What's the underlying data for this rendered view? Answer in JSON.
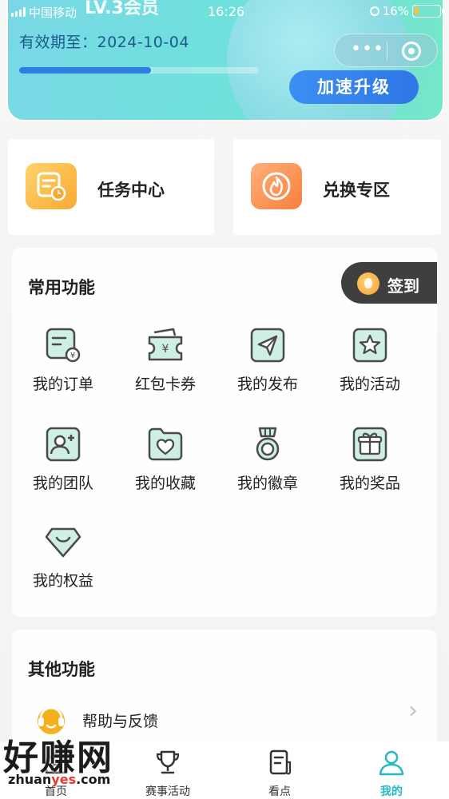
{
  "status_bar": {
    "carrier": "中国移动",
    "time": "16:26",
    "battery": "16%"
  },
  "vip_card": {
    "title_partial": "LV.3会员",
    "expiry_label": "有效期至：2024-10-04",
    "progress": 0.55,
    "upgrade_button": "加速升级"
  },
  "entries": {
    "task_center": "任务中心",
    "exchange_zone": "兑换专区"
  },
  "common": {
    "title": "常用功能",
    "checkin": "签到",
    "items": [
      {
        "label": "我的订单",
        "icon": "order-icon"
      },
      {
        "label": "红包卡券",
        "icon": "coupon-icon"
      },
      {
        "label": "我的发布",
        "icon": "publish-icon"
      },
      {
        "label": "我的活动",
        "icon": "activity-icon"
      },
      {
        "label": "我的团队",
        "icon": "team-icon"
      },
      {
        "label": "我的收藏",
        "icon": "favorite-icon"
      },
      {
        "label": "我的徽章",
        "icon": "badge-icon"
      },
      {
        "label": "我的奖品",
        "icon": "prize-icon"
      },
      {
        "label": "我的权益",
        "icon": "rights-icon"
      }
    ]
  },
  "other": {
    "title": "其他功能",
    "help": "帮助与反馈"
  },
  "tabs": [
    {
      "label": "首页",
      "icon": "home-icon"
    },
    {
      "label": "赛事活动",
      "icon": "trophy-icon"
    },
    {
      "label": "看点",
      "icon": "article-icon"
    },
    {
      "label": "我的",
      "icon": "profile-icon"
    }
  ],
  "watermark": {
    "brand": "好赚网",
    "domain_a": "zhuan",
    "domain_b": "yes",
    "domain_c": ".com"
  },
  "colors": {
    "accent": "#25b8c6",
    "upgrade": "#2f77e6",
    "icon_stroke": "#4a4a4a",
    "icon_fill": "#cfeee6"
  }
}
